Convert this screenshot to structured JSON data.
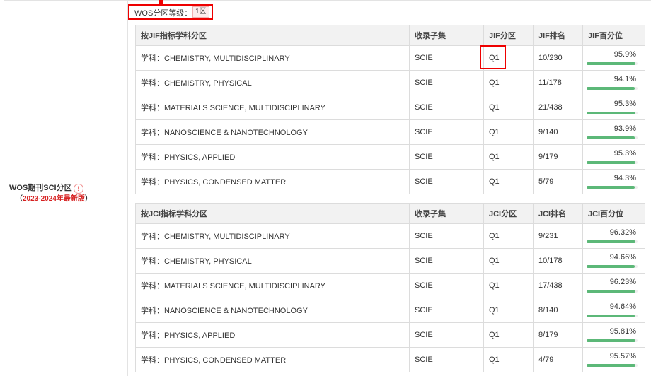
{
  "grade": {
    "label": "WOS分区等级：",
    "value": "1区"
  },
  "side": {
    "title": "WOS期刊SCI分区",
    "edition_open": "（",
    "edition": "2023-2024年最新版",
    "edition_close": "）"
  },
  "jif": {
    "headers": [
      "按JIF指标学科分区",
      "收录子集",
      "JIF分区",
      "JIF排名",
      "JIF百分位"
    ],
    "rows": [
      {
        "subject": "学科：CHEMISTRY, MULTIDISCIPLINARY",
        "subset": "SCIE",
        "quartile": "Q1",
        "rank": "10/230",
        "pct_text": "95.9%",
        "pct": 95.9
      },
      {
        "subject": "学科：CHEMISTRY, PHYSICAL",
        "subset": "SCIE",
        "quartile": "Q1",
        "rank": "11/178",
        "pct_text": "94.1%",
        "pct": 94.1
      },
      {
        "subject": "学科：MATERIALS SCIENCE, MULTIDISCIPLINARY",
        "subset": "SCIE",
        "quartile": "Q1",
        "rank": "21/438",
        "pct_text": "95.3%",
        "pct": 95.3
      },
      {
        "subject": "学科：NANOSCIENCE & NANOTECHNOLOGY",
        "subset": "SCIE",
        "quartile": "Q1",
        "rank": "9/140",
        "pct_text": "93.9%",
        "pct": 93.9
      },
      {
        "subject": "学科：PHYSICS, APPLIED",
        "subset": "SCIE",
        "quartile": "Q1",
        "rank": "9/179",
        "pct_text": "95.3%",
        "pct": 95.3
      },
      {
        "subject": "学科：PHYSICS, CONDENSED MATTER",
        "subset": "SCIE",
        "quartile": "Q1",
        "rank": "5/79",
        "pct_text": "94.3%",
        "pct": 94.3
      }
    ]
  },
  "jci": {
    "headers": [
      "按JCI指标学科分区",
      "收录子集",
      "JCI分区",
      "JCI排名",
      "JCI百分位"
    ],
    "rows": [
      {
        "subject": "学科：CHEMISTRY, MULTIDISCIPLINARY",
        "subset": "SCIE",
        "quartile": "Q1",
        "rank": "9/231",
        "pct_text": "96.32%",
        "pct": 96.32
      },
      {
        "subject": "学科：CHEMISTRY, PHYSICAL",
        "subset": "SCIE",
        "quartile": "Q1",
        "rank": "10/178",
        "pct_text": "94.66%",
        "pct": 94.66
      },
      {
        "subject": "学科：MATERIALS SCIENCE, MULTIDISCIPLINARY",
        "subset": "SCIE",
        "quartile": "Q1",
        "rank": "17/438",
        "pct_text": "96.23%",
        "pct": 96.23
      },
      {
        "subject": "学科：NANOSCIENCE & NANOTECHNOLOGY",
        "subset": "SCIE",
        "quartile": "Q1",
        "rank": "8/140",
        "pct_text": "94.64%",
        "pct": 94.64
      },
      {
        "subject": "学科：PHYSICS, APPLIED",
        "subset": "SCIE",
        "quartile": "Q1",
        "rank": "8/179",
        "pct_text": "95.81%",
        "pct": 95.81
      },
      {
        "subject": "学科：PHYSICS, CONDENSED MATTER",
        "subset": "SCIE",
        "quartile": "Q1",
        "rank": "4/79",
        "pct_text": "95.57%",
        "pct": 95.57
      }
    ]
  },
  "colors": {
    "bar_fill": "#5cb878",
    "highlight": "#e00000",
    "edition_text": "#d62020"
  },
  "icons": {
    "info": "info-circle-icon"
  }
}
